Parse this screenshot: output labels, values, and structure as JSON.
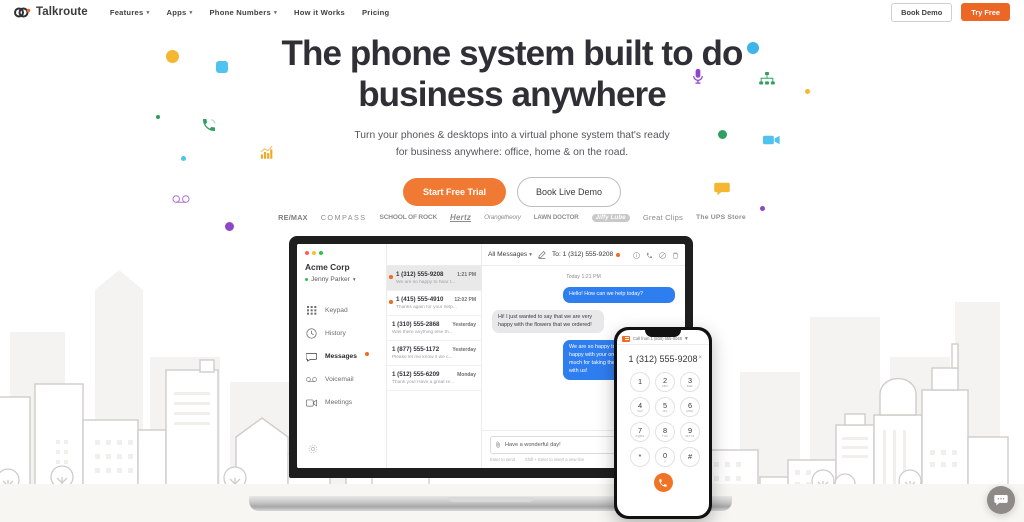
{
  "nav": {
    "logo_text": "Talkroute",
    "links": [
      {
        "label": "Features",
        "caret": true
      },
      {
        "label": "Apps",
        "caret": true
      },
      {
        "label": "Phone Numbers",
        "caret": true
      },
      {
        "label": "How it Works",
        "caret": false
      },
      {
        "label": "Pricing",
        "caret": false
      }
    ],
    "book_demo": "Book Demo",
    "try_free": "Try Free"
  },
  "hero": {
    "title_line1": "The phone system built to do",
    "title_line2": "business anywhere",
    "sub_line1": "Turn your phones & desktops into a virtual phone system that's ready",
    "sub_line2": "for business anywhere: office, home & on the road.",
    "cta_primary": "Start Free Trial",
    "cta_secondary": "Book Live Demo"
  },
  "clients": [
    "RE/MAX",
    "COMPASS",
    "SCHOOL OF ROCK",
    "Hertz",
    "Orangetheory",
    "LAWN DOCTOR",
    "Jiffy Lube",
    "Great Clips",
    "The UPS Store"
  ],
  "app": {
    "account": "Acme Corp",
    "user": "Jenny Parker",
    "menu": [
      {
        "label": "Keypad",
        "icon": "keypad-icon",
        "badge": false,
        "active": false
      },
      {
        "label": "History",
        "icon": "clock-icon",
        "badge": false,
        "active": false
      },
      {
        "label": "Messages",
        "icon": "message-icon",
        "badge": true,
        "active": true
      },
      {
        "label": "Voicemail",
        "icon": "voicemail-icon",
        "badge": false,
        "active": false
      },
      {
        "label": "Meetings",
        "icon": "video-icon",
        "badge": false,
        "active": false
      }
    ],
    "filter": "All Messages",
    "to_label": "To: 1 (312) 555-9208",
    "messages": [
      {
        "number": "1 (312) 555-9208",
        "time": "1:21 PM",
        "preview": "We are so happy to hear t...",
        "unread": true,
        "selected": true
      },
      {
        "number": "1 (415) 555-4910",
        "time": "12:02 PM",
        "preview": "Thanks again for your help...",
        "unread": true,
        "selected": false
      },
      {
        "number": "1 (310) 555-2868",
        "time": "Yesterday",
        "preview": "Was there anything else th...",
        "unread": false,
        "selected": false
      },
      {
        "number": "1 (877) 555-1172",
        "time": "Yesterday",
        "preview": "Please let me know if we c...",
        "unread": false,
        "selected": false
      },
      {
        "number": "1 (512) 555-6209",
        "time": "Monday",
        "preview": "Thank you! Have a great re...",
        "unread": false,
        "selected": false
      }
    ],
    "conversation": {
      "stamp": "Today 1:21 PM",
      "bubbles": [
        {
          "side": "out",
          "text": "Hello! How can we help today?"
        },
        {
          "side": "in",
          "text": "Hi! I just wanted to say that we are very happy with the flowers that we ordered!"
        },
        {
          "side": "out",
          "text": "We are so happy to hear that you are happy with your order. Thank you so much for taking the time to share a photo with us!"
        }
      ],
      "input_value": "Have a wonderful day!",
      "hint_send": "Enter to send",
      "hint_break": "Shift + Enter to insert a new line"
    }
  },
  "phone": {
    "caller_id": "Call from 1 (800) 555-0048",
    "number": "1 (312) 555-9208",
    "keys": [
      {
        "digit": "1",
        "letters": ""
      },
      {
        "digit": "2",
        "letters": "ABC"
      },
      {
        "digit": "3",
        "letters": "DEF"
      },
      {
        "digit": "4",
        "letters": "GHI"
      },
      {
        "digit": "5",
        "letters": "JKL"
      },
      {
        "digit": "6",
        "letters": "MNO"
      },
      {
        "digit": "7",
        "letters": "PQRS"
      },
      {
        "digit": "8",
        "letters": "TUV"
      },
      {
        "digit": "9",
        "letters": "WXYZ"
      },
      {
        "digit": "*",
        "letters": ""
      },
      {
        "digit": "0",
        "letters": "+"
      },
      {
        "digit": "#",
        "letters": ""
      }
    ]
  },
  "colors": {
    "brand_orange": "#ec6726",
    "cta_orange": "#f07a33",
    "bubble_blue": "#2f7ef0",
    "text_dark": "#2f2f35"
  },
  "chat_widget": {
    "icon": "chat-bubble-icon"
  }
}
